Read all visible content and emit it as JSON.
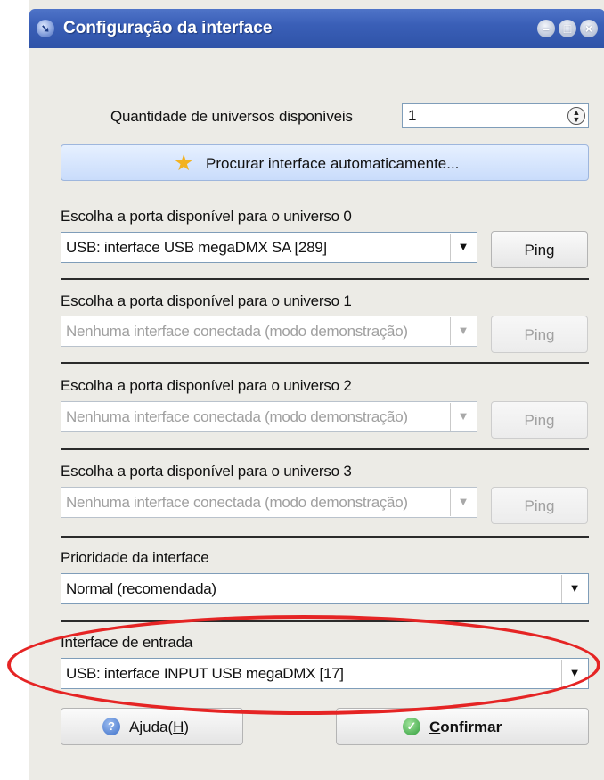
{
  "window": {
    "title": "Configuração da interface"
  },
  "universes": {
    "label": "Quantidade de universos disponíveis",
    "value": "1"
  },
  "search_button": {
    "label": "Procurar interface automaticamente..."
  },
  "ports": [
    {
      "label": "Escolha a porta disponível para o universo 0",
      "value": "USB: interface USB megaDMX SA [289]",
      "enabled": true,
      "ping": "Ping"
    },
    {
      "label": "Escolha a porta disponível para o universo 1",
      "value": "Nenhuma interface conectada (modo demonstração)",
      "enabled": false,
      "ping": "Ping"
    },
    {
      "label": "Escolha a porta disponível para o universo 2",
      "value": "Nenhuma interface conectada (modo demonstração)",
      "enabled": false,
      "ping": "Ping"
    },
    {
      "label": "Escolha a porta disponível para o universo 3",
      "value": "Nenhuma interface conectada (modo demonstração)",
      "enabled": false,
      "ping": "Ping"
    }
  ],
  "priority": {
    "label": "Prioridade da interface",
    "value": "Normal (recomendada)"
  },
  "input": {
    "label": "Interface de entrada",
    "value": "USB: interface INPUT USB megaDMX [17]"
  },
  "buttons": {
    "help_label": "Ajuda(",
    "help_key": "H",
    "help_close": ")",
    "confirm_key": "C",
    "confirm_rest": "onfirmar"
  },
  "colors": {
    "titlebar": "#3a5fb7",
    "highlight_ellipse": "#e52424",
    "search_button_bg": "#c9dcfb"
  },
  "icons": {
    "title": "app-icon",
    "search": "star-icon",
    "help": "help-icon",
    "confirm": "check-icon"
  }
}
